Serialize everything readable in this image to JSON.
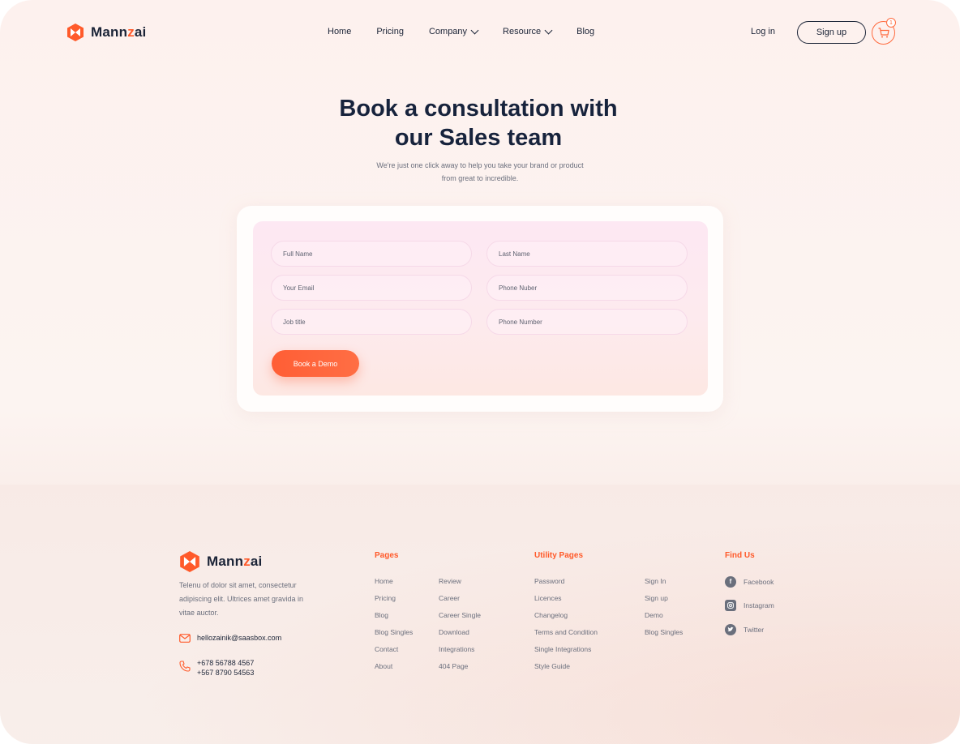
{
  "brand": {
    "name_prefix": "Mann",
    "name_accent": "z",
    "name_suffix": "ai",
    "accent_color": "#ff5a2a"
  },
  "nav": {
    "items": [
      {
        "label": "Home",
        "dropdown": false
      },
      {
        "label": "Pricing",
        "dropdown": false
      },
      {
        "label": "Company",
        "dropdown": true
      },
      {
        "label": "Resource",
        "dropdown": true
      },
      {
        "label": "Blog",
        "dropdown": false
      }
    ],
    "login": "Log in",
    "signup": "Sign up",
    "cart_count": "1",
    "cart_icon": "shopping-cart-icon"
  },
  "hero": {
    "title_line1": "Book a consultation with",
    "title_line2": "our Sales team",
    "subtitle_line1": "We're just one click away to help you take your brand or product",
    "subtitle_line2": "from great to incredible."
  },
  "form": {
    "full_name_placeholder": "Full Name",
    "last_name_placeholder": "Last Name",
    "email_placeholder": "Your Email",
    "phone_placeholder": "Phone Nuber",
    "job_title_placeholder": "Job title",
    "phone_number_placeholder": "Phone Number",
    "submit_label": "Book a Demo"
  },
  "footer": {
    "description_line1": "Telenu of dolor sit amet, consectetur",
    "description_line2": "adipiscing elit. Ultrices amet gravida in",
    "description_line3": "vitae auctor.",
    "email": "hellozainik@saasbox.com",
    "phone1": "+678 56788 4567",
    "phone2": "+567 8790 54563",
    "pages": {
      "heading": "Pages",
      "col1": [
        "Home",
        "Pricing",
        "Blog",
        "Blog Singles",
        "Contact",
        "About"
      ],
      "col2": [
        "Review",
        "Career",
        "Career Single",
        "Download",
        "Integrations",
        "404 Page"
      ]
    },
    "utility": {
      "heading": "Utility Pages",
      "col1": [
        "Password",
        "Licences",
        "Changelog",
        "Terms and Condition",
        "Single Integrations",
        "Style Guide"
      ],
      "col2": [
        "Sign In",
        "Sign up",
        "Demo",
        "Blog Singles"
      ]
    },
    "find_us": {
      "heading": "Find Us",
      "items": [
        {
          "label": "Facebook",
          "icon": "facebook-icon"
        },
        {
          "label": "Instagram",
          "icon": "instagram-icon"
        },
        {
          "label": "Twitter",
          "icon": "twitter-icon"
        }
      ]
    }
  }
}
